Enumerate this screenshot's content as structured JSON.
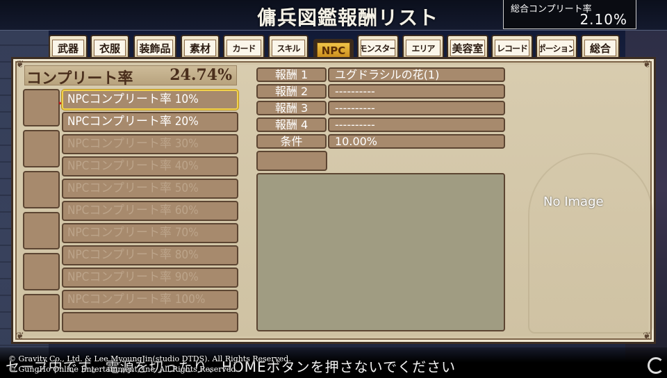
{
  "title": "傭兵図鑑報酬リスト",
  "total": {
    "label": "総合コンプリート率",
    "value": "2.10%"
  },
  "tabs": [
    {
      "label": "武器"
    },
    {
      "label": "衣服"
    },
    {
      "label": "装飾品"
    },
    {
      "label": "素材"
    },
    {
      "label": "カード"
    },
    {
      "label": "スキル"
    },
    {
      "label": "NPC"
    },
    {
      "label": "モンスター"
    },
    {
      "label": "エリア"
    },
    {
      "label": "美容室"
    },
    {
      "label": "レコード"
    },
    {
      "label": "ポーション"
    },
    {
      "label": "総合"
    }
  ],
  "completion": {
    "label": "コンプリート率",
    "value": "24.74%"
  },
  "rewards": [
    {
      "label": "NPCコンプリート率  10%"
    },
    {
      "label": "NPCコンプリート率  20%"
    },
    {
      "label": "NPCコンプリート率  30%"
    },
    {
      "label": "NPCコンプリート率  40%"
    },
    {
      "label": "NPCコンプリート率  50%"
    },
    {
      "label": "NPCコンプリート率  60%"
    },
    {
      "label": "NPCコンプリート率  70%"
    },
    {
      "label": "NPCコンプリート率  80%"
    },
    {
      "label": "NPCコンプリート率  90%"
    },
    {
      "label": "NPCコンプリート率  100%"
    }
  ],
  "detail": {
    "reward1_label": "報酬 1",
    "reward1_value": "ユグドラシルの花(1)",
    "reward2_label": "報酬 2",
    "reward2_value": "----------",
    "reward3_label": "報酬 3",
    "reward3_value": "----------",
    "reward4_label": "報酬 4",
    "reward4_value": "----------",
    "condition_label": "条件",
    "condition_value": "10.00%"
  },
  "no_image": "No Image",
  "warning": "セーブ中です。電源を切ったり、HOMEボタンを押さないでください",
  "copyright1": "© Gravity Co., Ltd. & Lee MyoungJin(studio DTDS). All Rights Reserved.",
  "copyright2": "© GungHo Online Entertainment, Inc. All Rights Reserved."
}
